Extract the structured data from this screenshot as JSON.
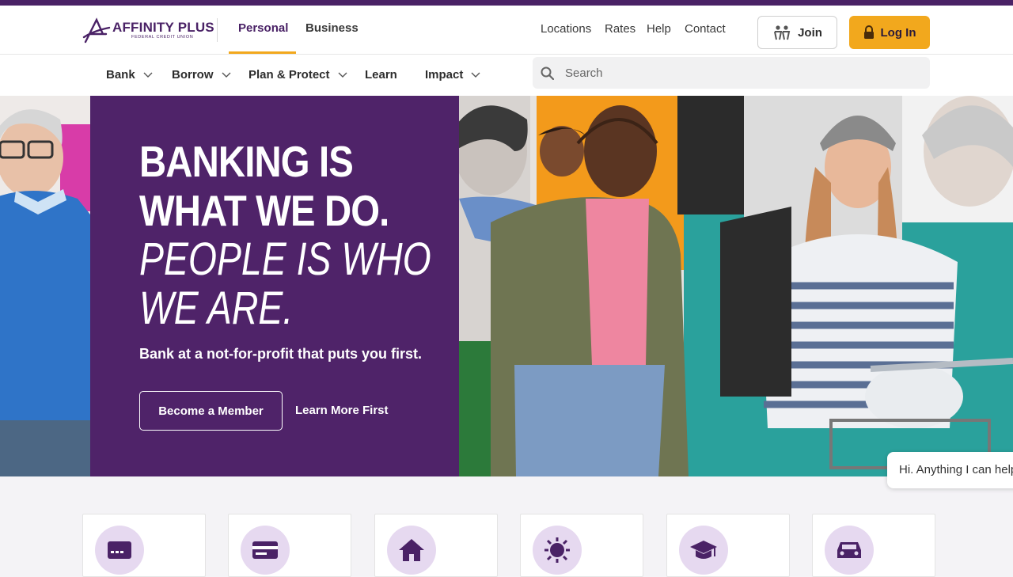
{
  "brand": {
    "name": "AFFINITY PLUS",
    "subtitle": "FEDERAL CREDIT UNION",
    "primary_color": "#4a2266",
    "accent_color": "#f2a81d"
  },
  "segments": [
    {
      "label": "Personal",
      "active": true
    },
    {
      "label": "Business",
      "active": false
    }
  ],
  "utility_links": [
    "Locations",
    "Rates",
    "Help",
    "Contact"
  ],
  "join_button": {
    "label": "Join",
    "icon": "people-icon"
  },
  "login_button": {
    "label": "Log In",
    "icon": "lock-icon"
  },
  "nav": [
    {
      "label": "Bank",
      "has_dropdown": true
    },
    {
      "label": "Borrow",
      "has_dropdown": true
    },
    {
      "label": "Plan & Protect",
      "has_dropdown": true
    },
    {
      "label": "Learn",
      "has_dropdown": false
    },
    {
      "label": "Impact",
      "has_dropdown": true
    }
  ],
  "search": {
    "placeholder": "Search",
    "icon": "search-icon"
  },
  "hero": {
    "headline_line1": "BANKING IS",
    "headline_line2": "WHAT WE DO.",
    "headline_italic_line1": "PEOPLE IS WHO",
    "headline_italic_line2": "WE ARE.",
    "subtext": "Bank at a not-for-profit that puts you first.",
    "primary_cta": "Become a Member",
    "secondary_cta": "Learn More First"
  },
  "chat": {
    "text": "Hi. Anything I can help you with?"
  },
  "cards": [
    {
      "icon": "credit-card-icon"
    },
    {
      "icon": "debit-card-icon"
    },
    {
      "icon": "home-icon"
    },
    {
      "icon": "sun-icon"
    },
    {
      "icon": "graduation-cap-icon"
    },
    {
      "icon": "car-icon"
    }
  ]
}
